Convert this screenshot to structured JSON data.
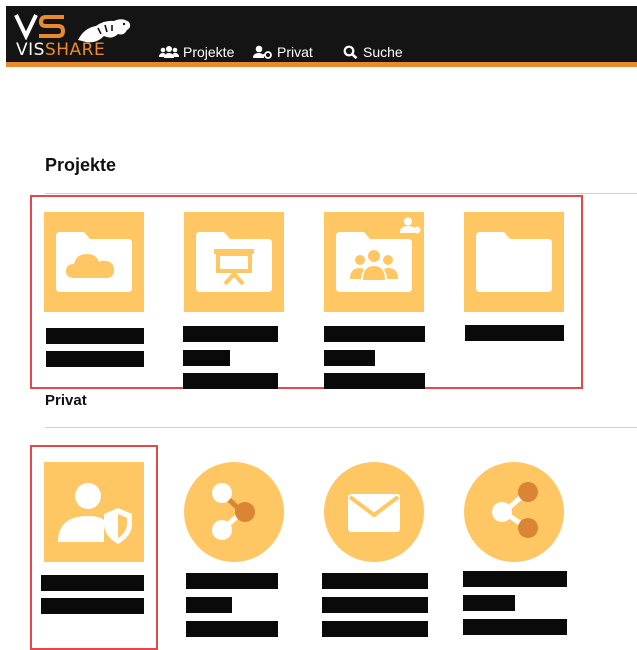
{
  "header": {
    "logo_text_white": "VIS",
    "logo_text_orange": "SHARE",
    "nav": [
      {
        "label": "Projekte",
        "icon": "users-icon"
      },
      {
        "label": "Privat",
        "icon": "user-key-icon"
      },
      {
        "label": "Suche",
        "icon": "search-icon"
      }
    ]
  },
  "colors": {
    "topbar": "#141414",
    "accent": "#e98a2f",
    "tile": "#ffc764",
    "tile_dark": "#d98534",
    "highlight": "#e8474a"
  },
  "sections": {
    "projekte": {
      "title": "Projekte",
      "items": [
        {
          "icon": "cloud-folder-icon"
        },
        {
          "icon": "presentation-folder-icon"
        },
        {
          "icon": "group-folder-icon",
          "badge": "shared-user-badge-icon"
        },
        {
          "icon": "folder-icon"
        }
      ]
    },
    "privat": {
      "title": "Privat",
      "items": [
        {
          "icon": "user-shield-icon"
        },
        {
          "icon": "share-icon"
        },
        {
          "icon": "mail-icon"
        },
        {
          "icon": "share-icon"
        }
      ]
    }
  }
}
